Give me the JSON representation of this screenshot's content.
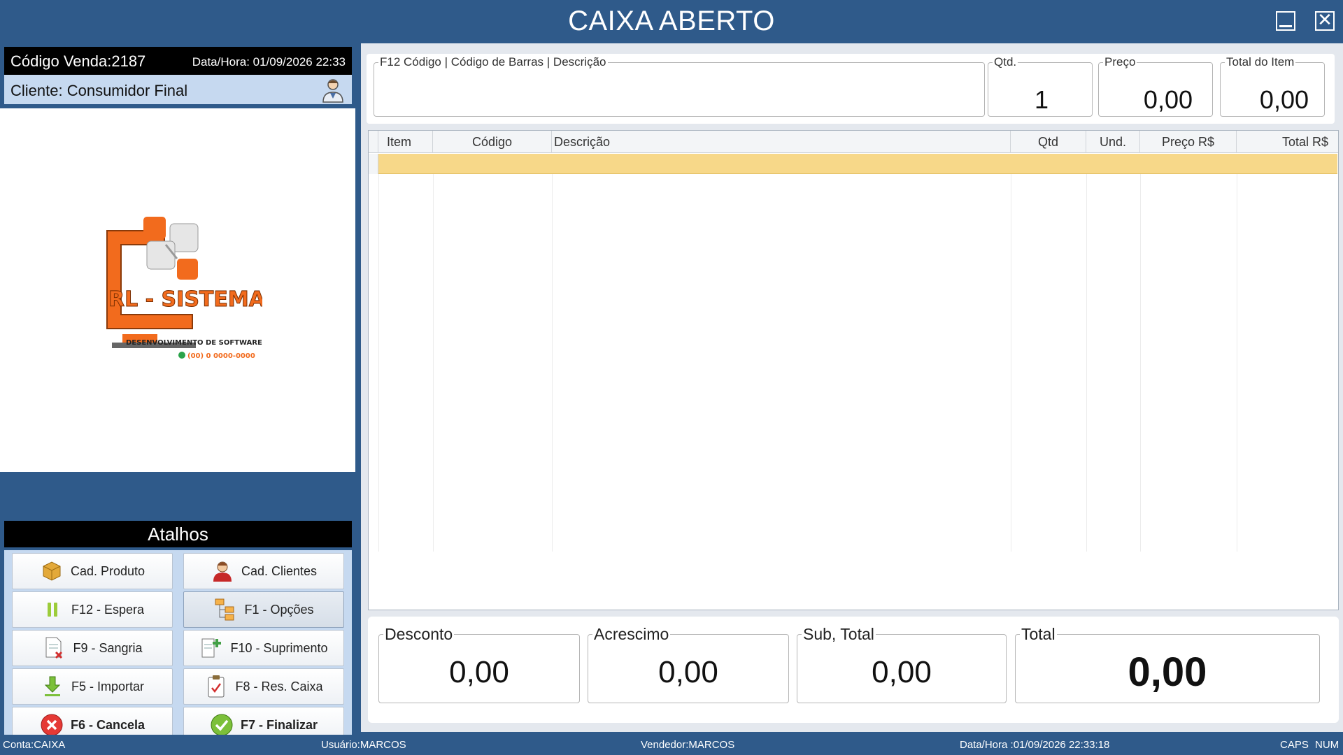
{
  "window": {
    "title": "CAIXA ABERTO"
  },
  "sale": {
    "code_label": "Código Venda:2187",
    "datetime_label": "Data/Hora: 01/09/2026 22:33",
    "client_label": "Cliente: Consumidor Final"
  },
  "logo": {
    "name": "RL - SISTEMAS",
    "tagline": "DESENVOLVIMENTO DE SOFTWARE",
    "phone": "(00) 0 0000-0000"
  },
  "shortcuts": {
    "header": "Atalhos",
    "buttons": [
      {
        "label": "Cad. Produto",
        "icon": "box-icon"
      },
      {
        "label": "Cad. Clientes",
        "icon": "person-icon"
      },
      {
        "label": "F12 - Espera",
        "icon": "pause-icon"
      },
      {
        "label": "F1 - Opções",
        "icon": "options-tree-icon"
      },
      {
        "label": "F9 - Sangria",
        "icon": "document-remove-icon"
      },
      {
        "label": "F10 - Suprimento",
        "icon": "document-add-icon"
      },
      {
        "label": "F5 - Importar",
        "icon": "download-icon"
      },
      {
        "label": "F8 - Res. Caixa",
        "icon": "clipboard-check-icon"
      },
      {
        "label": "F6 - Cancela",
        "icon": "cancel-icon"
      },
      {
        "label": "F7 - Finalizar",
        "icon": "check-icon"
      }
    ]
  },
  "entry": {
    "search_legend": "F12  Código | Código de Barras | Descrição",
    "search_value": "",
    "qty_legend": "Qtd.",
    "qty_value": "1",
    "price_legend": "Preço",
    "price_value": "0,00",
    "item_total_legend": "Total do Item",
    "item_total_value": "0,00"
  },
  "grid": {
    "columns": [
      "Item",
      "Código",
      "Descrição",
      "Qtd",
      "Und.",
      "Preço R$",
      "Total R$"
    ],
    "rows": []
  },
  "totals": {
    "discount_label": "Desconto",
    "discount_value": "0,00",
    "surcharge_label": "Acrescimo",
    "surcharge_value": "0,00",
    "subtotal_label": "Sub, Total",
    "subtotal_value": "0,00",
    "total_label": "Total",
    "total_value": "0,00"
  },
  "status": {
    "account": "Conta:CAIXA",
    "user": "Usuário:MARCOS",
    "seller": "Vendedor:MARCOS",
    "datetime": "Data/Hora :01/09/2026 22:33:18",
    "caps": "CAPS",
    "num": "NUM"
  },
  "colors": {
    "frame": "#2f5a8a",
    "client_bar": "#c6d9f0",
    "selected_row": "#f7d889",
    "logo_orange": "#f26b1d"
  }
}
